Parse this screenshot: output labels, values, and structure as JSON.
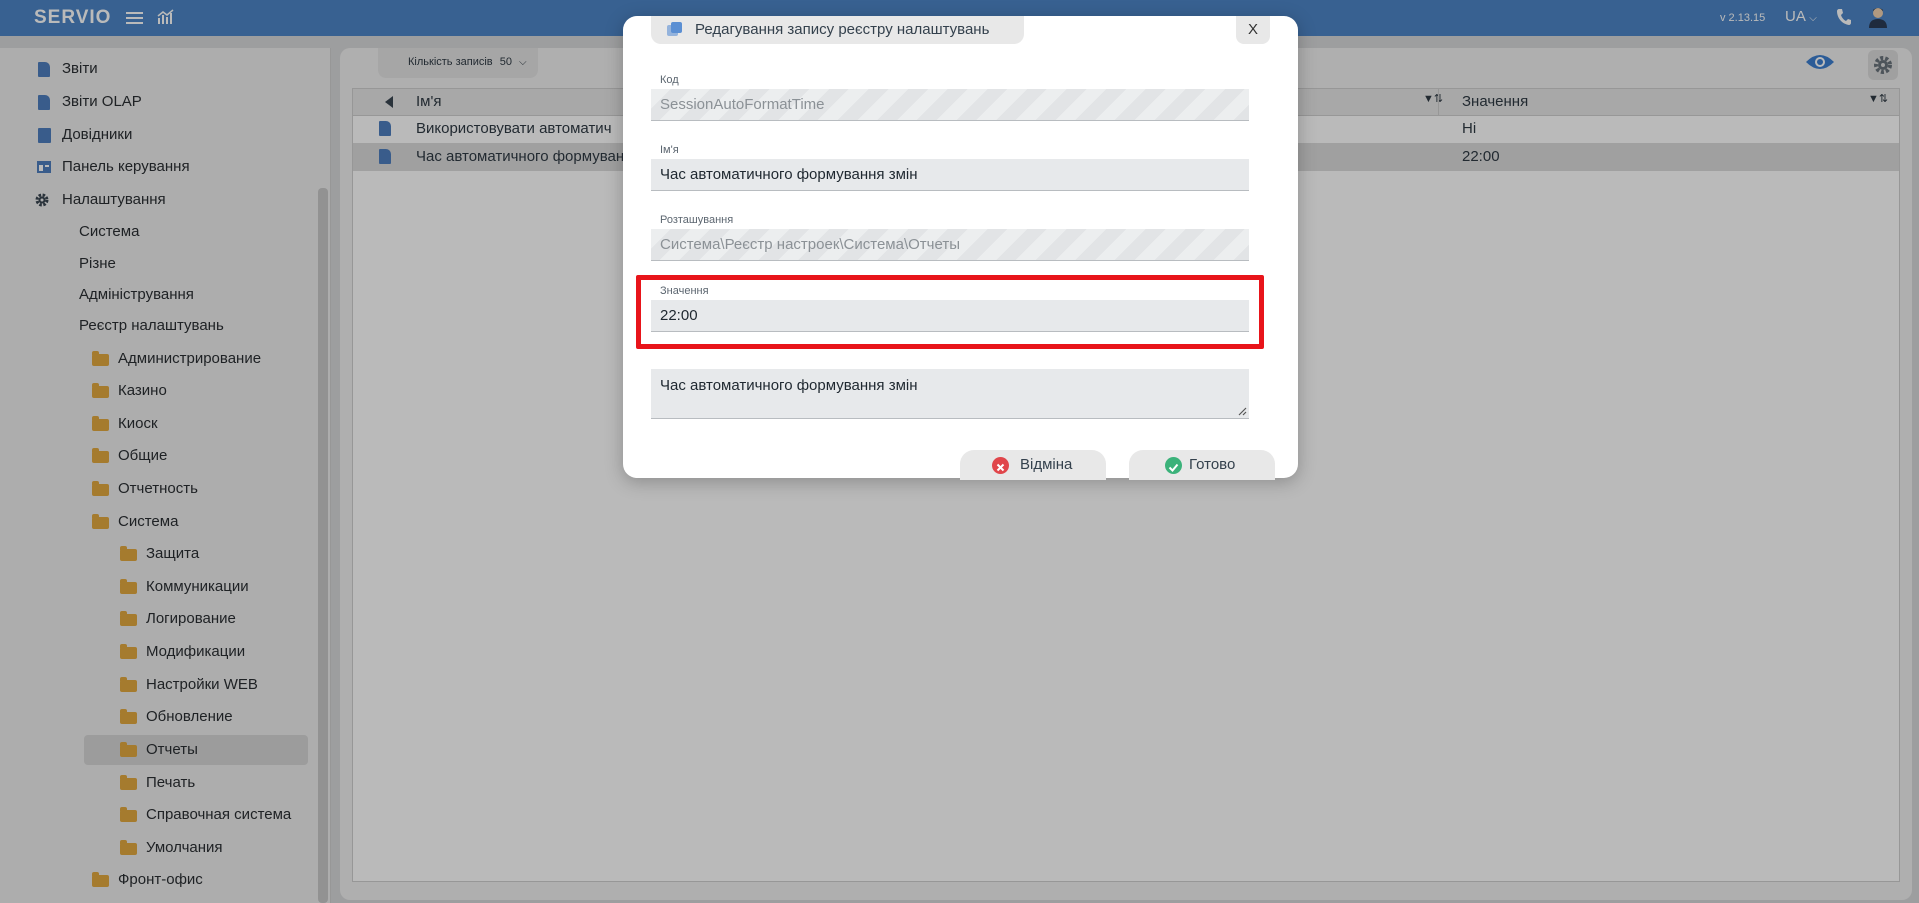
{
  "header": {
    "logo": "SERVIO",
    "version": "v 2.13.15",
    "language": "UA"
  },
  "sidebar": {
    "items": [
      {
        "label": "Звіти"
      },
      {
        "label": "Звіти OLAP"
      },
      {
        "label": "Довідники"
      },
      {
        "label": "Панель керування"
      },
      {
        "label": "Налаштування"
      },
      {
        "label": "Система"
      },
      {
        "label": "Різне"
      },
      {
        "label": "Адміністрування"
      },
      {
        "label": "Реєстр налаштувань"
      },
      {
        "label": "Администрирование"
      },
      {
        "label": "Казино"
      },
      {
        "label": "Киоск"
      },
      {
        "label": "Общие"
      },
      {
        "label": "Отчетность"
      },
      {
        "label": "Система"
      },
      {
        "label": "Защита"
      },
      {
        "label": "Коммуникации"
      },
      {
        "label": "Логирование"
      },
      {
        "label": "Модификации"
      },
      {
        "label": "Настройки WEB"
      },
      {
        "label": "Обновление"
      },
      {
        "label": "Отчеты"
      },
      {
        "label": "Печать"
      },
      {
        "label": "Справочная система"
      },
      {
        "label": "Умолчания"
      },
      {
        "label": "Фронт-офис"
      }
    ]
  },
  "main": {
    "records_label": "Кількість записів",
    "records_value": "50",
    "columns": [
      "Ім'я",
      "Значення"
    ],
    "rows": [
      {
        "name": "Використовувати автоматич",
        "value": "Ні"
      },
      {
        "name": "Час автоматичного формуван",
        "value": "22:00"
      }
    ]
  },
  "dialog": {
    "title": "Редагування запису реєстру налаштувань",
    "close_label": "X",
    "code_label": "Код",
    "code_value": "SessionAutoFormatTime",
    "name_label": "Ім'я",
    "name_value": "Час автоматичного формування змін",
    "location_label": "Розташування",
    "location_value": "Система\\Реєстр настроек\\Система\\Отчеты",
    "value_label": "Значення",
    "value_value": "22:00",
    "description_value": "Час автоматичного формування змін",
    "cancel_label": "Відміна",
    "ok_label": "Готово"
  },
  "colors": {
    "header": "#4d86c7",
    "highlight": "#e8141a",
    "folder": "#e3a93f",
    "cancel_icon": "#e0464b",
    "ok_icon": "#3bb27a"
  }
}
